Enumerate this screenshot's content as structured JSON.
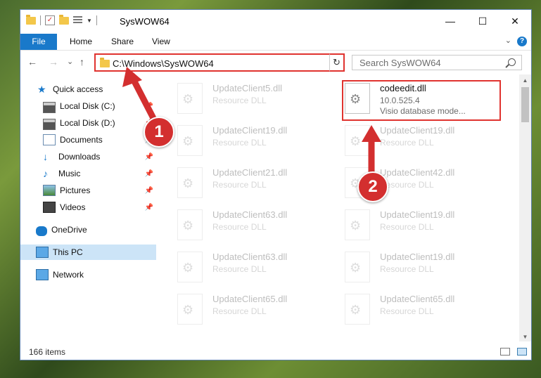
{
  "window": {
    "title": "SysWOW64"
  },
  "ribbon": {
    "tabs": [
      "File",
      "Home",
      "Share",
      "View"
    ],
    "help": "?"
  },
  "controls": {
    "minimize": "—",
    "maximize": "☐",
    "close": "✕"
  },
  "nav": {
    "back": "←",
    "forward": "→",
    "recent": "⌄",
    "up": "↑",
    "address": "C:\\Windows\\SysWOW64",
    "address_dropdown": "⌄",
    "refresh": "↻",
    "search_placeholder": "Search SysWOW64"
  },
  "sidebar": {
    "items": [
      {
        "label": "Quick access",
        "icon": "star-icon",
        "pinned": false
      },
      {
        "label": "Local Disk (C:)",
        "icon": "disk-icon",
        "pinned": true
      },
      {
        "label": "Local Disk (D:)",
        "icon": "disk-icon",
        "pinned": true
      },
      {
        "label": "Documents",
        "icon": "documents-icon",
        "pinned": true
      },
      {
        "label": "Downloads",
        "icon": "download-icon",
        "pinned": true
      },
      {
        "label": "Music",
        "icon": "music-icon",
        "pinned": true
      },
      {
        "label": "Pictures",
        "icon": "pictures-icon",
        "pinned": true
      },
      {
        "label": "Videos",
        "icon": "videos-icon",
        "pinned": true
      },
      {
        "label": "OneDrive",
        "icon": "cloud-icon",
        "pinned": false
      },
      {
        "label": "This PC",
        "icon": "pc-icon",
        "pinned": false,
        "selected": true
      },
      {
        "label": "Network",
        "icon": "network-icon",
        "pinned": false
      }
    ]
  },
  "files": {
    "left": [
      {
        "name": "UpdateClient5.dll",
        "type": "Resource DLL"
      },
      {
        "name": "UpdateClient19.dll",
        "type": "Resource DLL"
      },
      {
        "name": "UpdateClient21.dll",
        "type": "Resource DLL"
      },
      {
        "name": "UpdateClient63.dll",
        "type": "Resource DLL"
      },
      {
        "name": "UpdateClient63.dll",
        "type": "Resource DLL"
      },
      {
        "name": "UpdateClient65.dll",
        "type": "Resource DLL"
      }
    ],
    "right": [
      {
        "name": "codeedit.dll",
        "version": "10.0.525.4",
        "type": "Visio database mode...",
        "highlighted": true
      },
      {
        "name": "UpdateClient19.dll",
        "type": "Resource DLL"
      },
      {
        "name": "UpdateClient42.dll",
        "type": "Resource DLL"
      },
      {
        "name": "UpdateClient19.dll",
        "type": "Resource DLL"
      },
      {
        "name": "UpdateClient19.dll",
        "type": "Resource DLL"
      },
      {
        "name": "UpdateClient65.dll",
        "type": "Resource DLL"
      }
    ]
  },
  "status": {
    "item_count": "166 items"
  },
  "callouts": [
    "1",
    "2"
  ],
  "colors": {
    "accent": "#1979ca",
    "highlight": "#e0332f",
    "callout": "#d32f2f"
  }
}
